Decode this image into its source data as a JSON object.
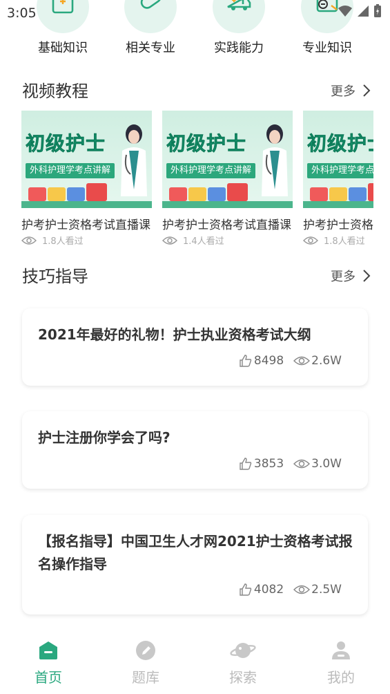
{
  "status_bar": {
    "time": "3:05"
  },
  "categories": [
    {
      "label": "基础知识",
      "icon": "clipboard-plus-icon"
    },
    {
      "label": "相关专业",
      "icon": "pill-icon"
    },
    {
      "label": "实践能力",
      "icon": "ambulance-icon"
    },
    {
      "label": "专业知识",
      "icon": "document-minus-icon"
    }
  ],
  "video_section": {
    "title": "视频教程",
    "more_label": "更多",
    "thumb_title": "初级护士",
    "thumb_banner": "外科护理学考点讲解",
    "videos": [
      {
        "title": "护考护士资格考试直播课",
        "views": "1.8人看过"
      },
      {
        "title": "护考护士资格考试直播课",
        "views": "1.4人看过"
      },
      {
        "title": "护考护士资格考试直播课",
        "views": "1.8人看过"
      }
    ]
  },
  "tips_section": {
    "title": "技巧指导",
    "more_label": "更多",
    "items": [
      {
        "title": "2021年最好的礼物！护士执业资格考试大纲",
        "likes": "8498",
        "views": "2.6W"
      },
      {
        "title": "护士注册你学会了吗?",
        "likes": "3853",
        "views": "3.0W"
      },
      {
        "title": "【报名指导】中国卫生人才网2021护士资格考试报名操作指导",
        "likes": "4082",
        "views": "2.5W"
      }
    ]
  },
  "bottom_nav": {
    "items": [
      {
        "label": "首页",
        "icon": "home-icon",
        "active": true
      },
      {
        "label": "题库",
        "icon": "pencil-icon",
        "active": false
      },
      {
        "label": "探索",
        "icon": "planet-icon",
        "active": false
      },
      {
        "label": "我的",
        "icon": "person-icon",
        "active": false
      }
    ]
  },
  "colors": {
    "accent": "#2aa87f",
    "icon_bg": "#e4f4ee",
    "inactive": "#bbbbbb"
  }
}
